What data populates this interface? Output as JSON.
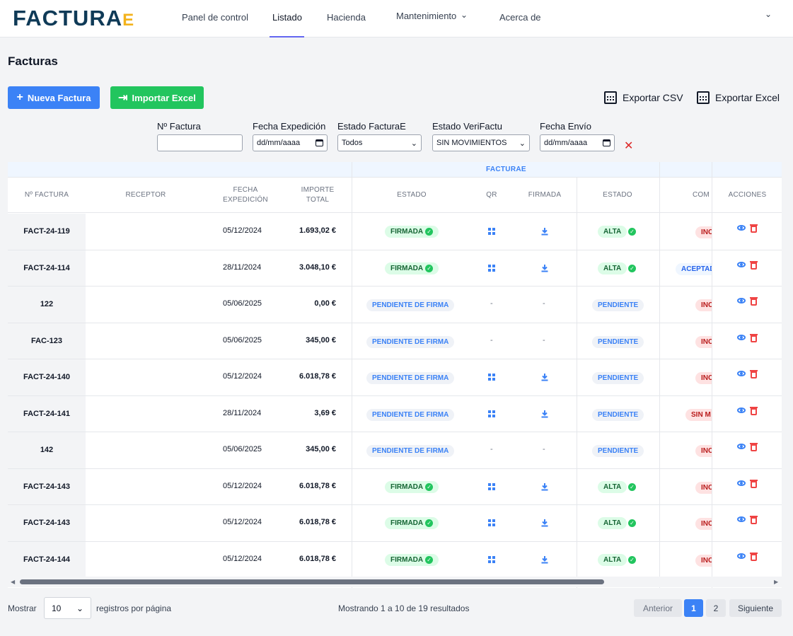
{
  "brand": {
    "logo_main": "FACTURA",
    "logo_suffix": "E"
  },
  "nav": {
    "items": [
      "Panel de control",
      "Listado",
      "Hacienda",
      "Mantenimiento",
      "Acerca de"
    ]
  },
  "page": {
    "title": "Facturas"
  },
  "toolbar": {
    "new_invoice": "Nueva Factura",
    "import_excel": "Importar Excel",
    "export_csv": "Exportar CSV",
    "export_excel": "Exportar Excel"
  },
  "filters": {
    "invoice_label": "Nº Factura",
    "invoice_value": "",
    "date_label": "Fecha Expedición",
    "date_value": "dd/mm/aaaa",
    "facturae_label": "Estado FacturaE",
    "facturae_value": "Todos",
    "verifactu_label": "Estado VeriFactu",
    "verifactu_value": "SIN MOVIMIENTOS",
    "send_label": "Fecha Envío",
    "send_value": "dd/mm/aaaa"
  },
  "table": {
    "group_facturae": "FACTURAE",
    "headers": {
      "num": "Nº FACTURA",
      "receptor": "RECEPTOR",
      "fecha_1": "FECHA",
      "fecha_2": "EXPEDICIÓN",
      "importe_1": "IMPORTE",
      "importe_2": "TOTAL",
      "estado": "ESTADO",
      "qr": "QR",
      "firmada": "FIRMADA",
      "estado_vf": "ESTADO",
      "com": "COM",
      "acciones": "ACCIONES"
    },
    "rows": [
      {
        "num": "FACT-24-119",
        "fecha": "05/12/2024",
        "importe": "1.693,02 €",
        "estado": "FIRMADA",
        "qr": true,
        "vf": "ALTA",
        "com": "INC"
      },
      {
        "num": "FACT-24-114",
        "fecha": "28/11/2024",
        "importe": "3.048,10 €",
        "estado": "FIRMADA",
        "qr": true,
        "vf": "ALTA",
        "com": "ACEPTAD"
      },
      {
        "num": "122",
        "fecha": "05/06/2025",
        "importe": "0,00 €",
        "estado": "PENDIENTE DE FIRMA",
        "qr": false,
        "vf": "PENDIENTE",
        "com": "INC"
      },
      {
        "num": "FAC-123",
        "fecha": "05/06/2025",
        "importe": "345,00 €",
        "estado": "PENDIENTE DE FIRMA",
        "qr": false,
        "vf": "PENDIENTE",
        "com": "INC"
      },
      {
        "num": "FACT-24-140",
        "fecha": "05/12/2024",
        "importe": "6.018,78 €",
        "estado": "PENDIENTE DE FIRMA",
        "qr": true,
        "vf": "PENDIENTE",
        "com": "INC"
      },
      {
        "num": "FACT-24-141",
        "fecha": "28/11/2024",
        "importe": "3,69 €",
        "estado": "PENDIENTE DE FIRMA",
        "qr": true,
        "vf": "PENDIENTE",
        "com": "SIN M"
      },
      {
        "num": "142",
        "fecha": "05/06/2025",
        "importe": "345,00 €",
        "estado": "PENDIENTE DE FIRMA",
        "qr": false,
        "vf": "PENDIENTE",
        "com": "INC"
      },
      {
        "num": "FACT-24-143",
        "fecha": "05/12/2024",
        "importe": "6.018,78 €",
        "estado": "FIRMADA",
        "qr": true,
        "vf": "ALTA",
        "com": "INC"
      },
      {
        "num": "FACT-24-143",
        "fecha": "05/12/2024",
        "importe": "6.018,78 €",
        "estado": "FIRMADA",
        "qr": true,
        "vf": "ALTA",
        "com": "INC"
      },
      {
        "num": "FACT-24-144",
        "fecha": "05/12/2024",
        "importe": "6.018,78 €",
        "estado": "FIRMADA",
        "qr": true,
        "vf": "ALTA",
        "com": "INC"
      }
    ],
    "dash": "-",
    "check_glyph": "✓"
  },
  "footer": {
    "show": "Mostrar",
    "per_page": "10",
    "per_page_suffix": "registros por página",
    "summary": "Mostrando 1 a 10 de 19 resultados",
    "prev": "Anterior",
    "page1": "1",
    "page2": "2",
    "next": "Siguiente"
  },
  "colors": {
    "primary": "#3b82f6",
    "success": "#22c55e",
    "danger": "#ef4444",
    "logo_blue": "#0f3a57",
    "logo_accent": "#f3b21b"
  },
  "icons": [
    "plus-icon",
    "file-import-icon",
    "spreadsheet-icon",
    "calendar-icon",
    "chevron-down-icon",
    "close-icon",
    "check-circle-icon",
    "qr-icon",
    "download-icon",
    "eye-icon",
    "trash-icon"
  ]
}
